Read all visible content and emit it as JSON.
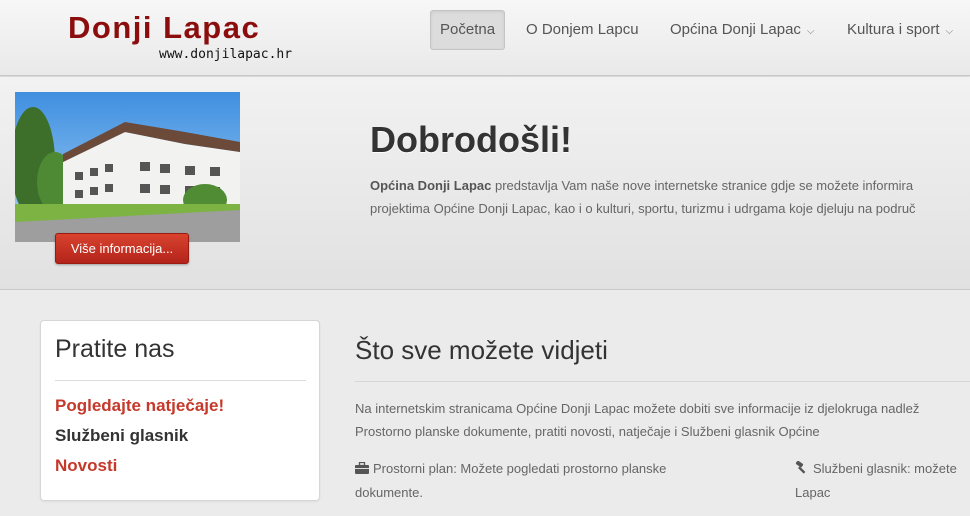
{
  "header": {
    "title": "Donji Lapac",
    "url": "www.donjilapac.hr",
    "nav": [
      {
        "label": "Početna",
        "active": true,
        "dropdown": false
      },
      {
        "label": "O Donjem Lapcu",
        "active": false,
        "dropdown": false
      },
      {
        "label": "Općina Donji Lapac",
        "active": false,
        "dropdown": true
      },
      {
        "label": "Kultura i sport",
        "active": false,
        "dropdown": true
      }
    ]
  },
  "hero": {
    "button_label": "Više informacija...",
    "title": "Dobrodošli!",
    "lead_bold": "Općina Donji Lapac",
    "line1_rest": " predstavlja Vam naše nove internetske stranice gdje se možete informira",
    "line2": "projektima Općine Donji Lapac, kao i o kulturi, sportu, turizmu i udrgama koje djeluju na područ"
  },
  "sidebar": {
    "title": "Pratite nas",
    "links": [
      {
        "label": "Pogledajte natječaje!",
        "color": "#c5392a"
      },
      {
        "label": "Službeni glasnik",
        "color": "#333333"
      },
      {
        "label": "Novosti",
        "color": "#c5392a"
      }
    ]
  },
  "main": {
    "title": "Što sve možete vidjeti",
    "text_line1": "Na internetskim stranicama Općine Donji Lapac možete dobiti sve informacije iz djelokruga nadlež",
    "text_line2": "Prostorno planske dokumente, pratiti novosti, natječaje i Službeni glasnik Općine",
    "features": [
      {
        "icon": "briefcase-icon",
        "line1": "Prostorni plan: Možete pogledati prostorno planske",
        "line2": "dokumente."
      },
      {
        "icon": "gavel-icon",
        "line1": "Službeni glasnik: možete",
        "line2": "Lapac"
      }
    ]
  },
  "colors": {
    "brand": "#8b0d0d",
    "accent_red": "#c5392a",
    "button_red": "#c8321f"
  }
}
